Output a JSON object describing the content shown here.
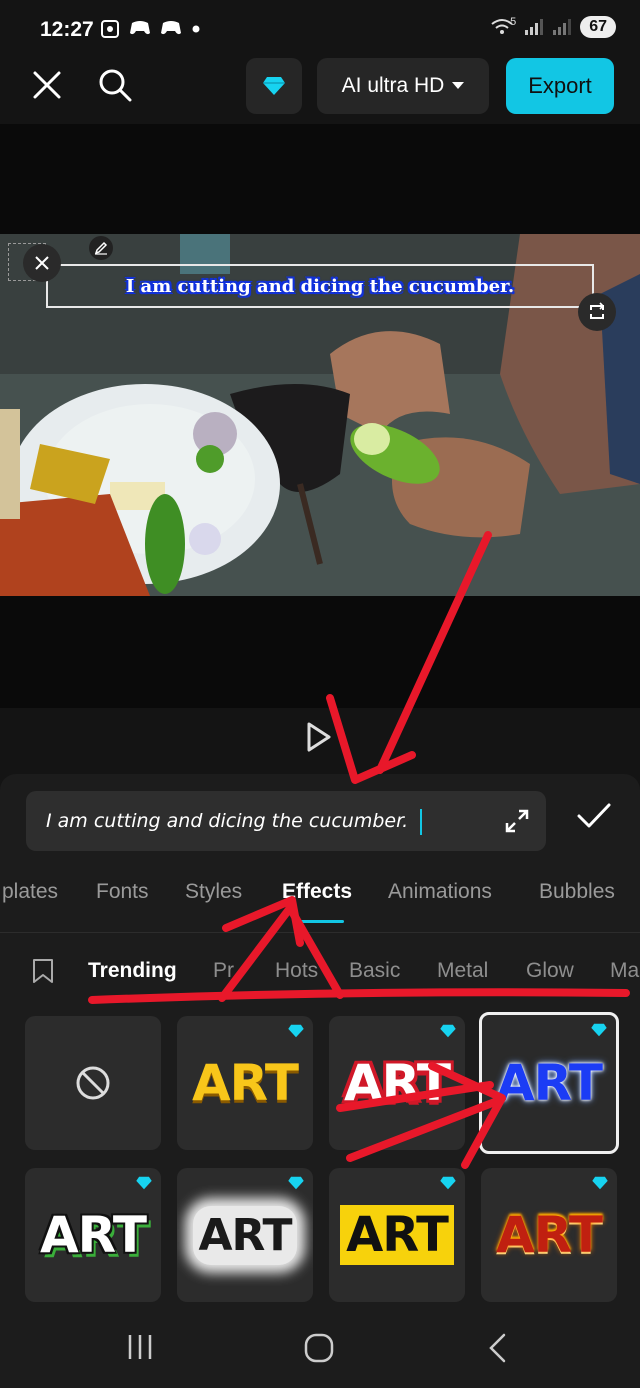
{
  "status_bar": {
    "time": "12:27",
    "left_icons": [
      "screenshot-icon",
      "game-icon",
      "game-icon",
      "dot-icon"
    ],
    "battery": "67",
    "network": "5"
  },
  "toolbar": {
    "quality_label": "AI ultra HD",
    "export_label": "Export"
  },
  "preview": {
    "caption": "I am cutting and dicing the cucumber."
  },
  "editor": {
    "input_value": "I am cutting and dicing the cucumber.",
    "tabs": [
      {
        "label": "plates"
      },
      {
        "label": "Fonts"
      },
      {
        "label": "Styles"
      },
      {
        "label": "Effects"
      },
      {
        "label": "Animations"
      },
      {
        "label": "Bubbles"
      }
    ],
    "active_tab": "Effects",
    "subtabs": [
      {
        "label": "Trending"
      },
      {
        "label": "Pr"
      },
      {
        "label": "Hots"
      },
      {
        "label": "Basic"
      },
      {
        "label": "Metal"
      },
      {
        "label": "Glow"
      },
      {
        "label": "Ma"
      }
    ],
    "active_subtab": "Trending",
    "effect_tiles": [
      {
        "label": "",
        "style": "none"
      },
      {
        "label": "ART",
        "style": "yellow"
      },
      {
        "label": "ART",
        "style": "red-outline"
      },
      {
        "label": "ART",
        "style": "blue-glow",
        "selected": true
      },
      {
        "label": "ART",
        "style": "green-outline"
      },
      {
        "label": "ART",
        "style": "cloud"
      },
      {
        "label": "ART",
        "style": "black-yellow"
      },
      {
        "label": "ART",
        "style": "fire"
      }
    ]
  },
  "colors": {
    "accent": "#12c6e4",
    "annotation": "#e8182a",
    "background": "#141414",
    "sheet": "#1c1c1c"
  }
}
